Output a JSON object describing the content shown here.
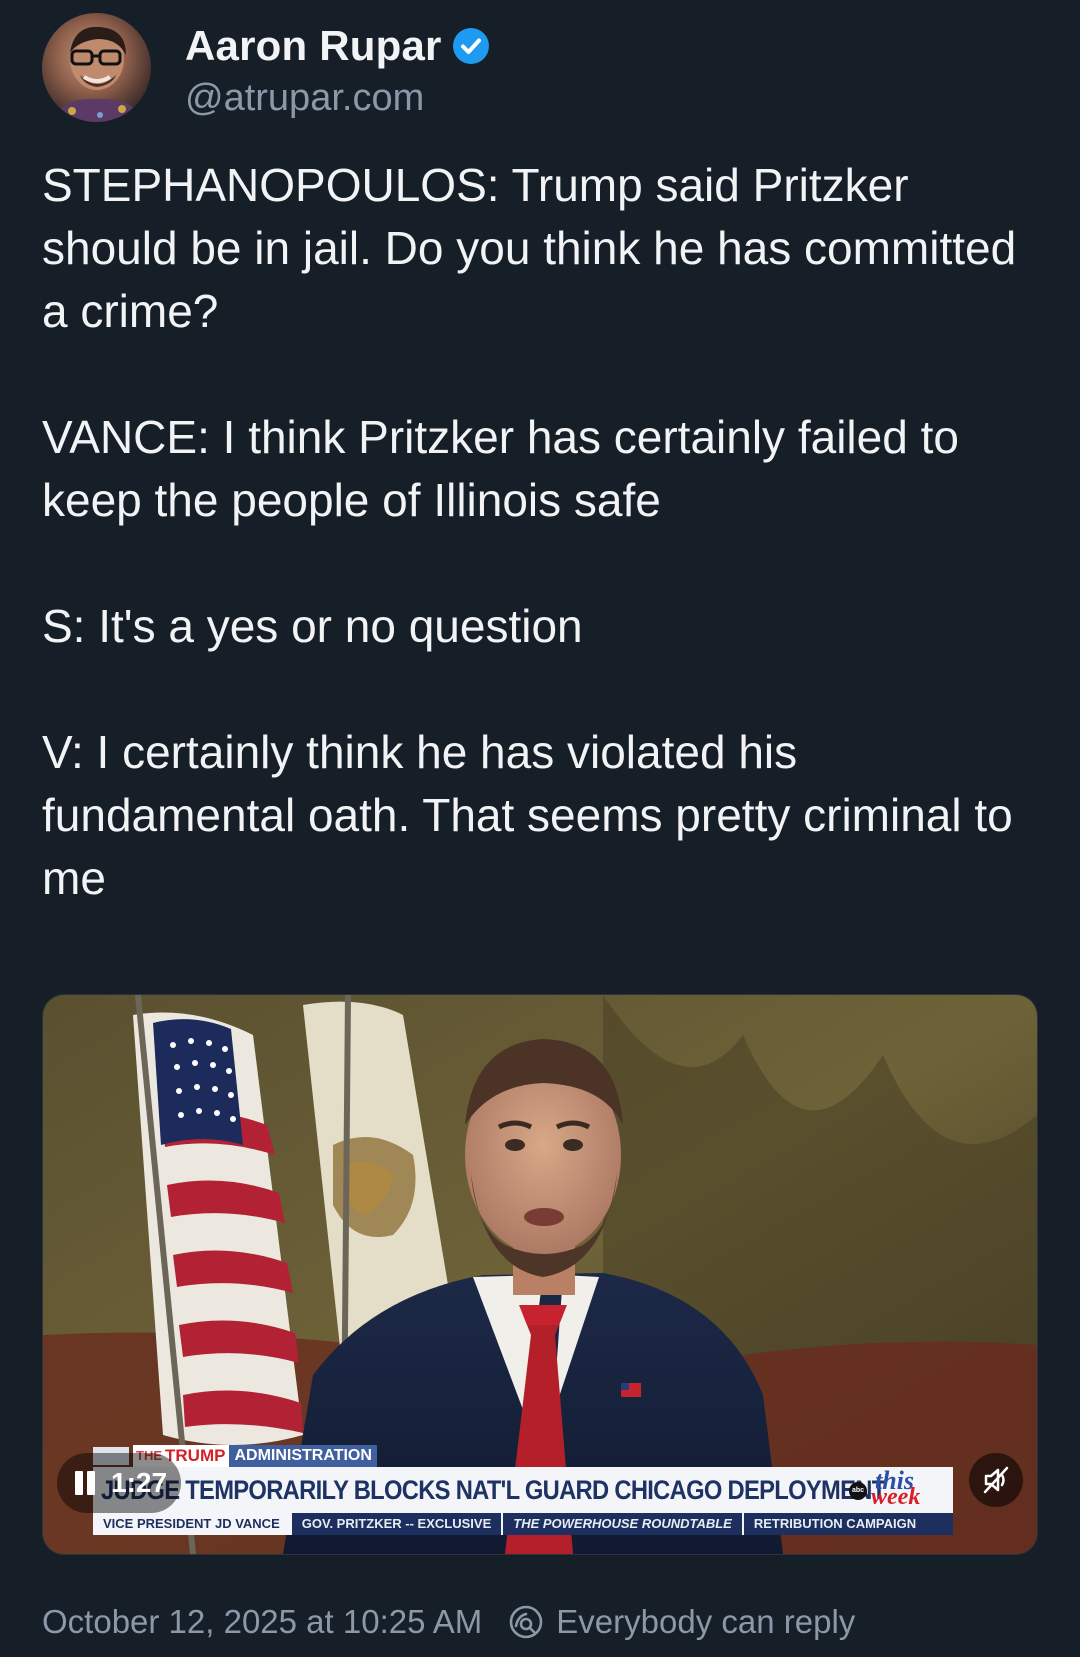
{
  "author": {
    "display_name": "Aaron Rupar",
    "handle": "@atrupar.com",
    "verified": true,
    "verified_color": "#1d9bf0"
  },
  "post": {
    "text": "STEPHANOPOULOS: Trump said Pritzker should be in jail. Do you think he has committed a crime?\n\nVANCE: I think Pritzker has certainly failed to keep the people of Illinois safe\n\nS: It's a yes or no question\n\nV: I certainly think he has violated his fundamental oath. That seems pretty criminal to me"
  },
  "video": {
    "time": "1:27",
    "state": "playing",
    "muted": true,
    "chyron": {
      "the": "THE",
      "trump": "TRUMP",
      "admin": "ADMINISTRATION",
      "headline": "JUDGE TEMPORARILY BLOCKS NAT'L GUARD CHICAGO DEPLOYMENT",
      "show_this": "this",
      "show_week": "week",
      "network": "abc",
      "ticker": [
        "VICE PRESIDENT JD VANCE",
        "GOV. PRITZKER -- EXCLUSIVE",
        "THE POWERHOUSE ROUNDTABLE",
        "RETRIBUTION CAMPAIGN"
      ]
    }
  },
  "footer": {
    "timestamp": "October 12, 2025 at 10:25 AM",
    "reply_setting": "Everybody can reply"
  },
  "icons": {
    "verified": "verified-badge-icon",
    "pause": "pause-icon",
    "mute": "muted-speaker-icon",
    "reply": "reply-permission-icon"
  },
  "colors": {
    "background": "#161e27",
    "text": "#f1f3f5",
    "muted_text": "#8b98a8",
    "accent": "#1d9bf0"
  }
}
